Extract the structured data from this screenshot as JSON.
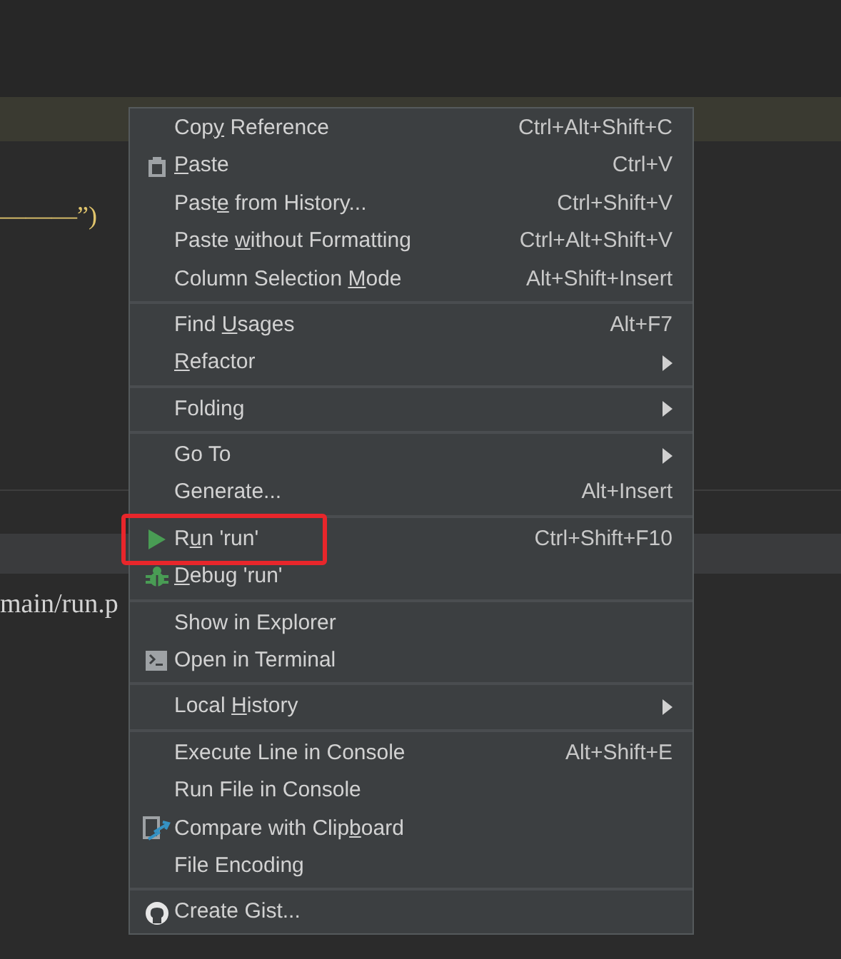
{
  "editor": {
    "code_line": "———”)",
    "path_text": "main/run.p"
  },
  "menu": {
    "groups": [
      {
        "items": [
          {
            "kind": "plain",
            "label_start": "Cop",
            "mnemonic": "y",
            "label_end": " Reference",
            "shortcut": "Ctrl+Alt+Shift+C"
          },
          {
            "kind": "clipboard",
            "mnemonic": "P",
            "label_end": "aste",
            "shortcut": "Ctrl+V"
          },
          {
            "kind": "plain",
            "label_start": "Past",
            "mnemonic": "e",
            "label_end": " from History...",
            "shortcut": "Ctrl+Shift+V"
          },
          {
            "kind": "plain",
            "label_start": "Paste ",
            "mnemonic": "w",
            "label_end": "ithout Formatting",
            "shortcut": "Ctrl+Alt+Shift+V"
          },
          {
            "kind": "plain",
            "label_start": "Column Selection ",
            "mnemonic": "M",
            "label_end": "ode",
            "shortcut": "Alt+Shift+Insert"
          }
        ]
      },
      {
        "items": [
          {
            "kind": "plain",
            "label_start": "Find ",
            "mnemonic": "U",
            "label_end": "sages",
            "shortcut": "Alt+F7"
          },
          {
            "kind": "plain",
            "mnemonic": "R",
            "label_end": "efactor",
            "submenu": true
          }
        ]
      },
      {
        "items": [
          {
            "kind": "plain",
            "label_start": "Folding",
            "submenu": true
          }
        ]
      },
      {
        "items": [
          {
            "kind": "plain",
            "label_start": "Go To",
            "submenu": true
          },
          {
            "kind": "plain",
            "label_start": "Generate...",
            "shortcut": "Alt+Insert"
          }
        ]
      },
      {
        "items": [
          {
            "kind": "play",
            "label_start": "R",
            "mnemonic": "u",
            "label_end": "n 'run'",
            "shortcut": "Ctrl+Shift+F10",
            "highlighted": true
          },
          {
            "kind": "bug",
            "mnemonic": "D",
            "label_end": "ebug 'run'"
          }
        ]
      },
      {
        "items": [
          {
            "kind": "plain",
            "label_start": "Show in Explorer"
          },
          {
            "kind": "terminal",
            "label_start": "Open in Terminal"
          }
        ]
      },
      {
        "items": [
          {
            "kind": "plain",
            "label_start": "Local ",
            "mnemonic": "H",
            "label_end": "istory",
            "submenu": true
          }
        ]
      },
      {
        "items": [
          {
            "kind": "plain",
            "label_start": "Execute Line in Console",
            "shortcut": "Alt+Shift+E"
          },
          {
            "kind": "plain",
            "label_start": "Run File in Console"
          },
          {
            "kind": "compare",
            "label_start": "Compare with Clip",
            "mnemonic": "b",
            "label_end": "oard"
          },
          {
            "kind": "plain",
            "label_start": "File Encoding"
          }
        ]
      },
      {
        "items": [
          {
            "kind": "github",
            "label_start": "Create Gist..."
          }
        ]
      }
    ]
  }
}
